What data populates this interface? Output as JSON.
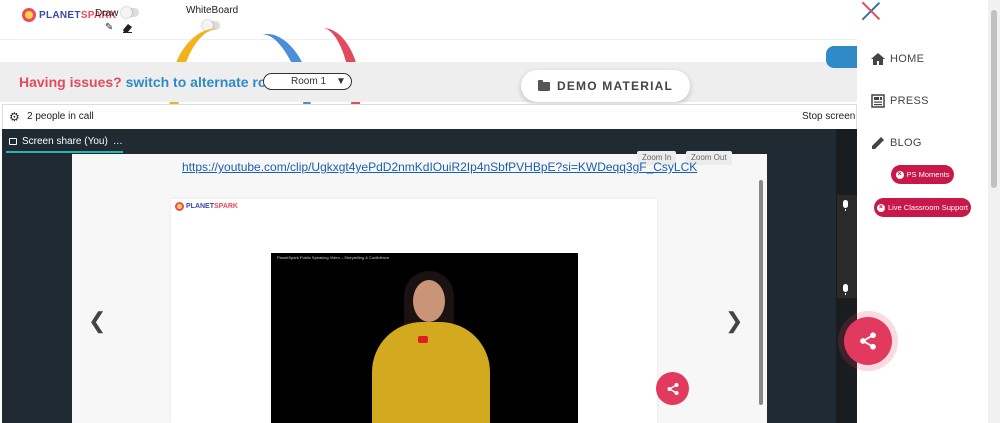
{
  "topbar": {
    "logo_text_a": "PLANET",
    "logo_text_b": "SPARK",
    "draw_label": "Draw",
    "whiteboard_label": "WhiteBoard"
  },
  "issue": {
    "label_red": "Having issues?",
    "label_blue": "switch to alternate room",
    "room_value": "Room 1",
    "demo_label": "DEMO MATERIAL"
  },
  "call": {
    "people_count": "2 people in call",
    "stop_label": "Stop screen"
  },
  "share": {
    "tab_label": "Screen share (You)",
    "tab_more": "…",
    "link": "https://youtube.com/clip/Ugkxgt4yePdD2nmKdIOuiR2Ip4nSbfPVHBpE?si=KWDeqq3gF_CsyLCK",
    "zoom_in": "Zoom In",
    "zoom_out": "Zoom Out",
    "card_logo_a": "PLANET",
    "card_logo_b": "SPARK",
    "video_title": "PlanetSpark Public Speaking Video – Storytelling & Confidence"
  },
  "sidebar": {
    "home": "HOME",
    "press": "PRESS",
    "blog": "BLOG",
    "ps_moments": "PS Moments",
    "live_support": "Live Classroom Support"
  },
  "colors": {
    "brand_red": "#e24a5e",
    "brand_blue": "#2e8bc8",
    "fab_pink": "#e2395e",
    "pill_crimson": "#c8184a",
    "dark_panel": "#1f2a33"
  }
}
